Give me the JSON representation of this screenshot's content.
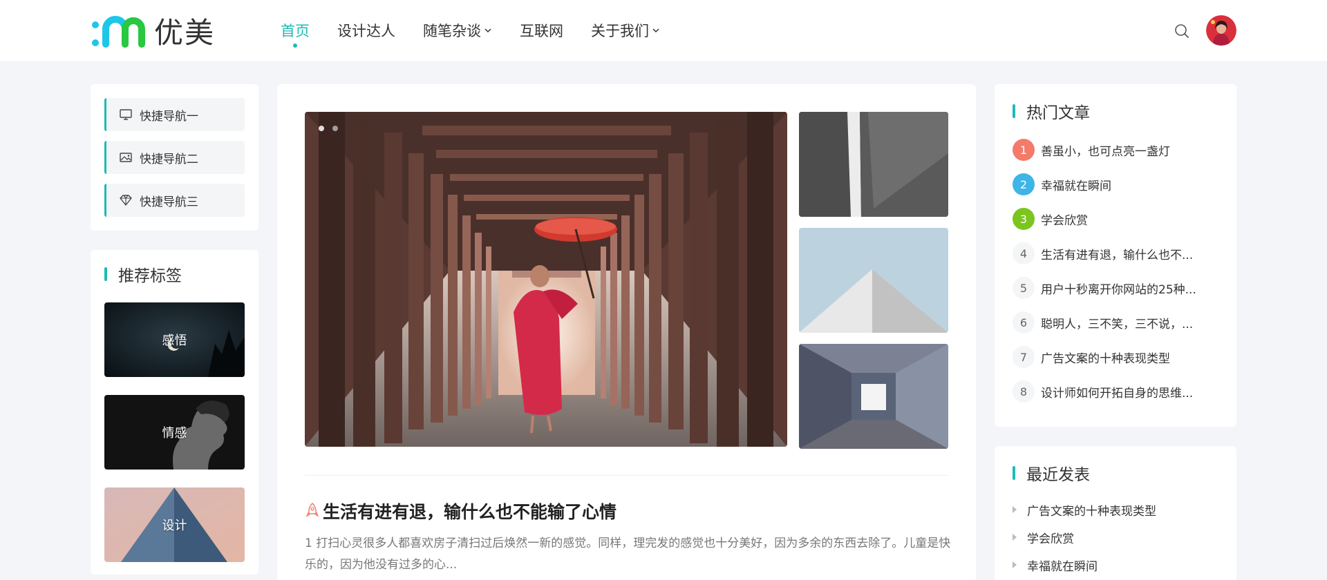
{
  "brand": {
    "name": "优美",
    "accent": "#1cbbb4"
  },
  "nav": [
    {
      "label": "首页",
      "active": true,
      "dropdown": false
    },
    {
      "label": "设计达人",
      "active": false,
      "dropdown": false
    },
    {
      "label": "随笔杂谈",
      "active": false,
      "dropdown": true
    },
    {
      "label": "互联网",
      "active": false,
      "dropdown": false
    },
    {
      "label": "关于我们",
      "active": false,
      "dropdown": true
    }
  ],
  "header": {
    "search_icon": "search-icon",
    "avatar_icon": "user-avatar"
  },
  "quick_nav": [
    {
      "label": "快捷导航一",
      "icon": "monitor-icon"
    },
    {
      "label": "快捷导航二",
      "icon": "image-icon"
    },
    {
      "label": "快捷导航三",
      "icon": "diamond-icon"
    }
  ],
  "tags": {
    "title": "推荐标签",
    "items": [
      {
        "label": "感悟"
      },
      {
        "label": "情感"
      },
      {
        "label": "设计"
      }
    ]
  },
  "carousel": {
    "slides": 2,
    "current": 1
  },
  "article": {
    "title": "生活有进有退，输什么也不能输了心情",
    "excerpt": "1 打扫心灵很多人都喜欢房子清扫过后焕然一新的感觉。同样，理完发的感觉也十分美好，因为多余的东西去除了。儿童是快乐的，因为他没有过多的心..."
  },
  "hot": {
    "title": "热门文章",
    "rank_colors": [
      "#f47a6a",
      "#3db5e6",
      "#7cc51e"
    ],
    "items": [
      {
        "rank": "1",
        "title": "善虽小，也可点亮一盏灯"
      },
      {
        "rank": "2",
        "title": "幸福就在瞬间"
      },
      {
        "rank": "3",
        "title": "学会欣赏"
      },
      {
        "rank": "4",
        "title": "生活有进有退，输什么也不..."
      },
      {
        "rank": "5",
        "title": "用户十秒离开你网站的25种..."
      },
      {
        "rank": "6",
        "title": "聪明人，三不笑，三不说，..."
      },
      {
        "rank": "7",
        "title": "广告文案的十种表现类型"
      },
      {
        "rank": "8",
        "title": "设计师如何开拓自身的思维..."
      }
    ]
  },
  "recent": {
    "title": "最近发表",
    "items": [
      {
        "title": "广告文案的十种表现类型"
      },
      {
        "title": "学会欣赏"
      },
      {
        "title": "幸福就在瞬间"
      }
    ]
  }
}
